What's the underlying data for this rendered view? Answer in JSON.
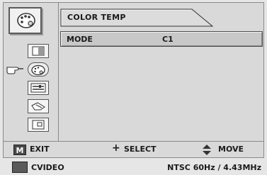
{
  "header": {
    "title": "COLOR TEMP"
  },
  "settings": [
    {
      "label": "MODE",
      "value": "C1"
    }
  ],
  "side_menu": {
    "items": [
      {
        "icon": "picture-pattern-icon"
      },
      {
        "icon": "color-palette-icon"
      },
      {
        "icon": "adjust-panel-icon"
      },
      {
        "icon": "hand-setup-icon"
      },
      {
        "icon": "screen-frame-icon"
      }
    ],
    "selected_index": 1
  },
  "footer": {
    "menu_key": "M",
    "exit_label": "EXIT",
    "select_symbol": "+",
    "select_label": "SELECT",
    "move_label": "MOVE"
  },
  "status": {
    "source": "CVIDEO",
    "signal": "NTSC 60Hz / 4.43MHz"
  }
}
